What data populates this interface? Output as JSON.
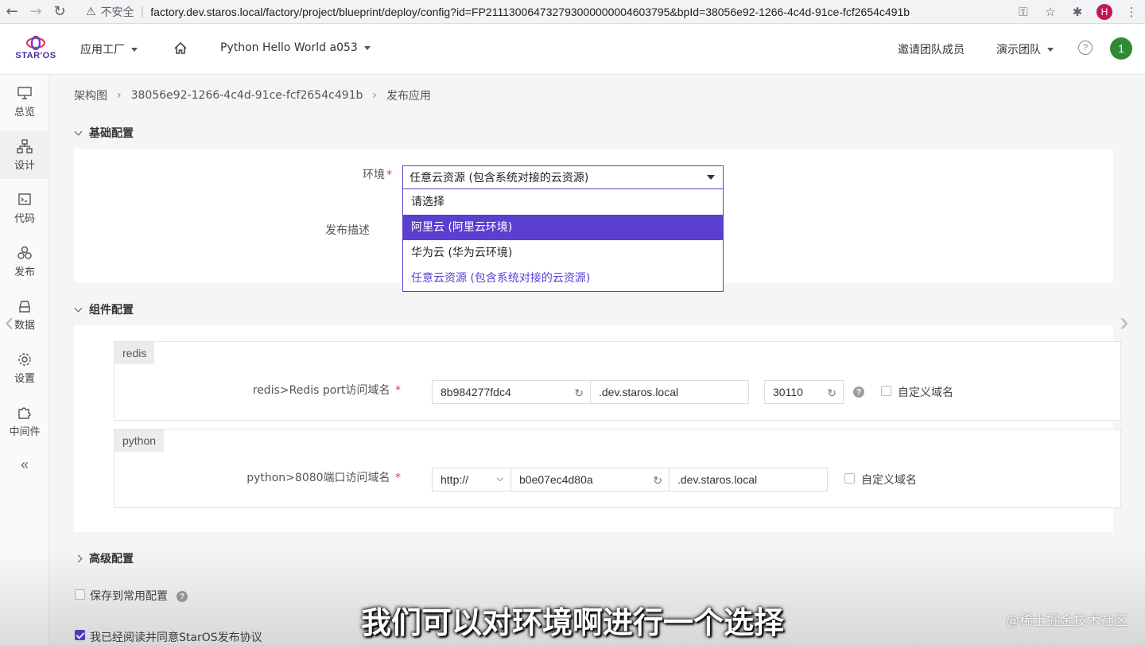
{
  "browser": {
    "insecure_label": "不安全",
    "url": "factory.dev.staros.local/factory/project/blueprint/deploy/config?id=FP211130064732793000000004603795&bpId=38056e92-1266-4c4d-91ce-fcf2654c491b",
    "profile_initial": "H"
  },
  "header": {
    "logo_text": "STAR'OS",
    "app_menu": "应用工厂",
    "project_menu": "Python Hello World a053",
    "invite": "邀请团队成员",
    "team_menu": "演示团队",
    "help": "?",
    "user_initial": "1",
    "brand_color": "#5b3fd1"
  },
  "sidebar": {
    "items": [
      {
        "label": "总览",
        "icon": "monitor-icon"
      },
      {
        "label": "设计",
        "icon": "sitemap-icon"
      },
      {
        "label": "代码",
        "icon": "code-icon"
      },
      {
        "label": "发布",
        "icon": "cluster-icon"
      },
      {
        "label": "数据",
        "icon": "database-icon"
      },
      {
        "label": "设置",
        "icon": "gear-icon"
      },
      {
        "label": "中间件",
        "icon": "puzzle-icon"
      }
    ],
    "collapse": "«"
  },
  "breadcrumb": {
    "items": [
      "架构图",
      "38056e92-1266-4c4d-91ce-fcf2654c491b",
      "发布应用"
    ]
  },
  "basic": {
    "title": "基础配置",
    "env_label": "环境",
    "env_value": "任意云资源 (包含系统对接的云资源)",
    "desc_label": "发布描述",
    "options": [
      "请选择",
      "阿里云 (阿里云环境)",
      "华为云 (华为云环境)",
      "任意云资源 (包含系统对接的云资源)"
    ]
  },
  "component": {
    "title": "组件配置",
    "redis": {
      "tag": "redis",
      "label": "redis>Redis port访问域名",
      "subdomain": "8b984277fdc4",
      "domain": ".dev.staros.local",
      "port": "30110",
      "custom_label": "自定义域名"
    },
    "python": {
      "tag": "python",
      "label": "python>8080端口访问域名",
      "protocol": "http://",
      "subdomain": "b0e07ec4d80a",
      "domain": ".dev.staros.local",
      "custom_label": "自定义域名"
    }
  },
  "advanced": {
    "title": "高级配置",
    "save_label": "保存到常用配置",
    "agree_label": "我已经阅读并同意StarOS发布协议"
  },
  "overlay": {
    "subtitle": "我们可以对环境啊进行一个选择",
    "watermark": "@稀土掘金技术社区"
  }
}
